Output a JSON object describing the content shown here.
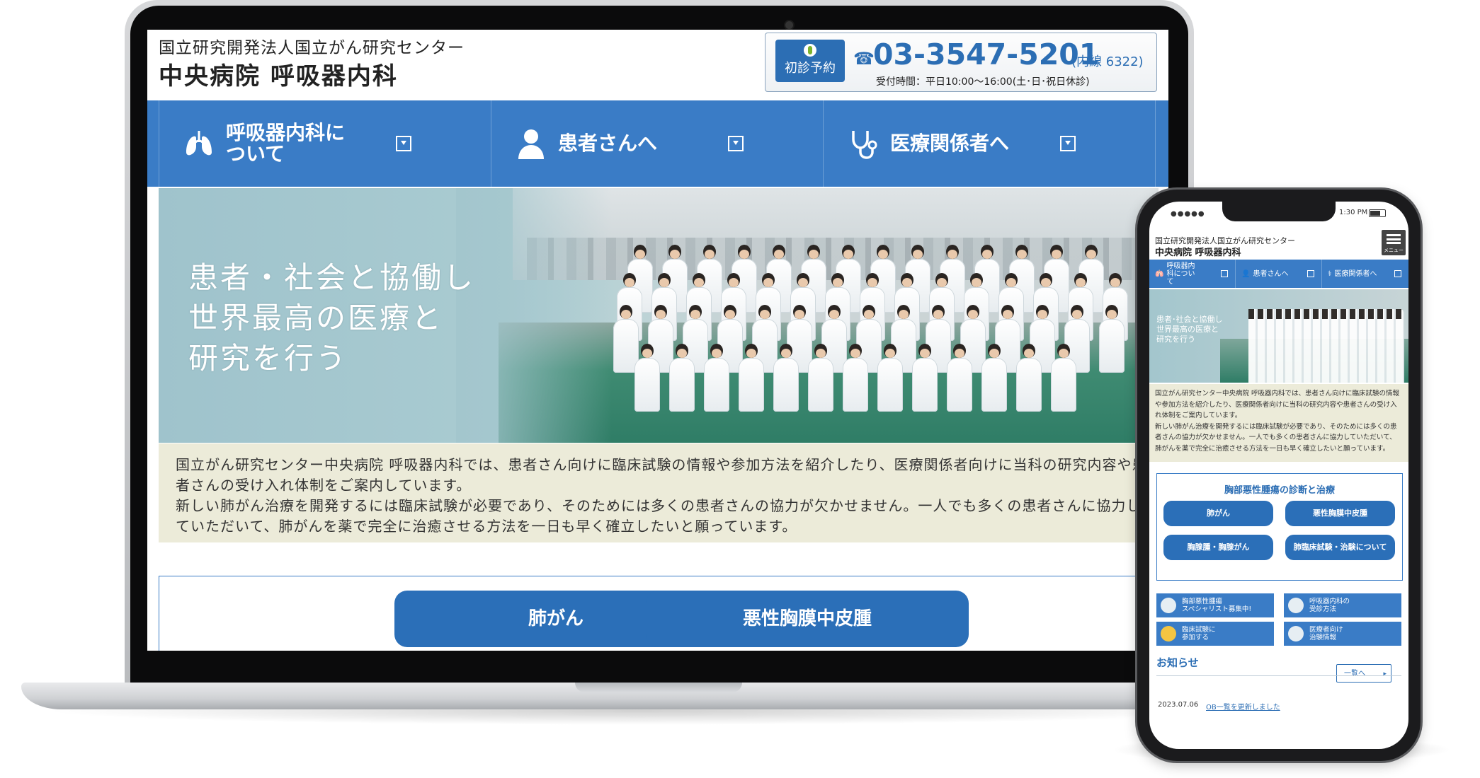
{
  "desktop": {
    "header": {
      "org": "国立研究開発法人国立がん研究センター",
      "dept": "中央病院 呼吸器内科",
      "first_visit_label": "初診予約",
      "phone_number": "03-3547-5201",
      "extension": "(内線 6322)",
      "hours": "受付時間：平日10:00〜16:00(土･日･祝日休診)"
    },
    "nav": [
      {
        "label": "呼吸器内科について"
      },
      {
        "label": "患者さんへ"
      },
      {
        "label": "医療関係者へ"
      }
    ],
    "hero": {
      "lines": [
        "患者・社会と協働し",
        "世界最高の医療と",
        "研究を行う"
      ]
    },
    "intro": "国立がん研究センター中央病院 呼吸器内科では、患者さん向けに臨床試験の情報や参加方法を紹介したり、医療関係者向けに当科の研究内容や患者さんの受け入れ体制をご案内しています。\n新しい肺がん治療を開発するには臨床試験が必要であり、そのためには多くの患者さんの協力が欠かせません。一人でも多くの患者さんに協力していただいて、肺がんを薬で完全に治癒させる方法を一日も早く確立したいと願っています。",
    "buttons": [
      "肺がん",
      "悪性胸膜中皮腫"
    ]
  },
  "mobile": {
    "status": {
      "signal": "●●●●●",
      "time": "1:30 PM"
    },
    "header": {
      "org": "国立研究開発法人国立がん研究センター",
      "dept": "中央病院 呼吸器内科",
      "menu_label": "メニュー"
    },
    "nav": [
      {
        "label": "呼吸器内科について"
      },
      {
        "label": "患者さんへ"
      },
      {
        "label": "医療関係者へ"
      }
    ],
    "hero_text": "患者･社会と協働し\n世界最高の医療と\n研究を行う",
    "intro": "国立がん研究センター中央病院 呼吸器内科では、患者さん向けに臨床試験の情報や参加方法を紹介したり、医療関係者向けに当科の研究内容や患者さんの受け入れ体制をご案内しています。\n新しい肺がん治療を開発するには臨床試験が必要であり、そのためには多くの患者さんの協力が欠かせません。一人でも多くの患者さんに協力していただいて、肺がんを薬で完全に治癒させる方法を一日も早く確立したいと願っています。",
    "diag_title": "胸部悪性腫瘍の診断と治療",
    "diag_buttons": [
      "肺がん",
      "悪性胸膜中皮腫",
      "胸腺腫・胸腺がん",
      "肺臨床試験・治験について"
    ],
    "links": [
      {
        "label": "胸部悪性腫瘍\nスペシャリスト募集中!"
      },
      {
        "label": "呼吸器内科の\n受診方法"
      },
      {
        "label": "臨床試験に\n参加する"
      },
      {
        "label": "医療者向け\n治験情報"
      }
    ],
    "news": {
      "title": "お知らせ",
      "more": "一覧へ",
      "items": [
        {
          "date": "2023.07.06",
          "text": "OB一覧を更新しました"
        }
      ]
    }
  }
}
